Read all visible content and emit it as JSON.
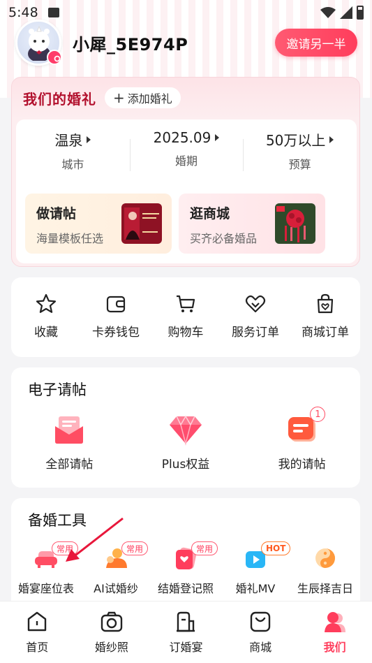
{
  "status_bar": {
    "time": "5:48"
  },
  "profile": {
    "username": "小犀_5E974P",
    "invite_button": "邀请另一半"
  },
  "wedding": {
    "title": "我们的婚礼",
    "add_button": "添加婚礼",
    "stats": [
      {
        "value": "温泉",
        "label": "城市"
      },
      {
        "value": "2025.09",
        "label": "婚期"
      },
      {
        "value": "50万以上",
        "label": "预算"
      }
    ],
    "promos": [
      {
        "title": "做请帖",
        "subtitle": "海量模板任选"
      },
      {
        "title": "逛商城",
        "subtitle": "买齐必备婚品"
      }
    ]
  },
  "quick_links": [
    {
      "label": "收藏",
      "icon": "star-icon"
    },
    {
      "label": "卡券钱包",
      "icon": "wallet-icon"
    },
    {
      "label": "购物车",
      "icon": "cart-icon"
    },
    {
      "label": "服务订单",
      "icon": "heart-order-icon"
    },
    {
      "label": "商城订单",
      "icon": "bag-order-icon"
    }
  ],
  "invitations": {
    "title": "电子请帖",
    "items": [
      {
        "label": "全部请帖",
        "icon": "envelope-icon"
      },
      {
        "label": "Plus权益",
        "icon": "diamond-icon"
      },
      {
        "label": "我的请帖",
        "icon": "card-icon",
        "badge": "1"
      }
    ]
  },
  "tools": {
    "title": "备婚工具",
    "items": [
      {
        "label": "婚宴座位表",
        "tag": "常用",
        "icon": "sofa-icon"
      },
      {
        "label": "AI试婚纱",
        "tag": "常用",
        "icon": "person-icon"
      },
      {
        "label": "结婚登记照",
        "tag": "常用",
        "icon": "photo-icon"
      },
      {
        "label": "婚礼MV",
        "tag": "HOT",
        "icon": "play-icon"
      },
      {
        "label": "生辰择吉日",
        "icon": "yinyang-icon"
      }
    ]
  },
  "bottom_nav": [
    {
      "label": "首页",
      "icon": "home-icon"
    },
    {
      "label": "婚纱照",
      "icon": "camera-icon"
    },
    {
      "label": "订婚宴",
      "icon": "banquet-icon"
    },
    {
      "label": "商城",
      "icon": "shop-icon"
    },
    {
      "label": "我们",
      "icon": "us-icon",
      "active": true
    }
  ],
  "colors": {
    "accent": "#ff3d5c",
    "title_red": "#b2102d"
  }
}
